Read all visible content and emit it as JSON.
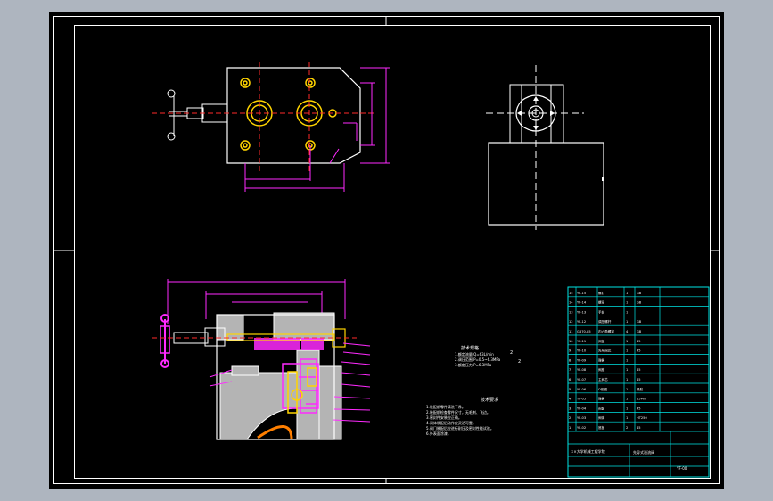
{
  "title_block": {
    "tech_title": "技术要求",
    "notes": [
      "1.装配前零件清洗干净。",
      "2.装配前检查零件尺寸，无毛刺、飞边。",
      "3.密封件安装应正确。",
      "4.阀体装配后动作应灵活可靠。",
      "5.阀门装配后应进行耐压及密封性能试验。",
      "6.外表面涂漆。"
    ],
    "spec_title": "技术规格",
    "specs": [
      "1.额定流量  Q=63L/min",
      "2.调压范围  P=0.5~6.3MPa",
      "3.额定压力  P=6.3MPa"
    ],
    "spec_marks": [
      "2",
      "2"
    ],
    "drawing_name": "先导式溢流阀",
    "drawing_code": "YF-00",
    "school": "××大学机械工程学院",
    "rows": [
      [
        "15",
        "YF-15",
        "螺钉",
        "1",
        "GB"
      ],
      [
        "14",
        "YF-14",
        "螺母",
        "1",
        "GB"
      ],
      [
        "13",
        "YF-13",
        "手轮",
        "1",
        ""
      ],
      [
        "12",
        "YF-12",
        "调压螺杆",
        "1",
        "GB"
      ],
      [
        "11",
        "GB70-85",
        "内六角螺钉",
        "4",
        "GB"
      ],
      [
        "10",
        "YF-11",
        "阀盖",
        "1",
        "45"
      ],
      [
        "9",
        "YF-10",
        "先导阀芯",
        "1",
        "45"
      ],
      [
        "8",
        "YF-09",
        "弹簧",
        "1",
        ""
      ],
      [
        "7",
        "YF-08",
        "阀座",
        "1",
        "45"
      ],
      [
        "6",
        "YF-07",
        "主阀芯",
        "1",
        "45"
      ],
      [
        "5",
        "YF-06",
        "O形圈",
        "1",
        "橡胶"
      ],
      [
        "4",
        "YF-05",
        "弹簧",
        "1",
        "65Mn"
      ],
      [
        "3",
        "YF-04",
        "阀套",
        "1",
        "45"
      ],
      [
        "2",
        "YF-03",
        "阀体",
        "1",
        "HT250"
      ],
      [
        "1",
        "YF-02",
        "底板",
        "2",
        "45"
      ]
    ]
  }
}
